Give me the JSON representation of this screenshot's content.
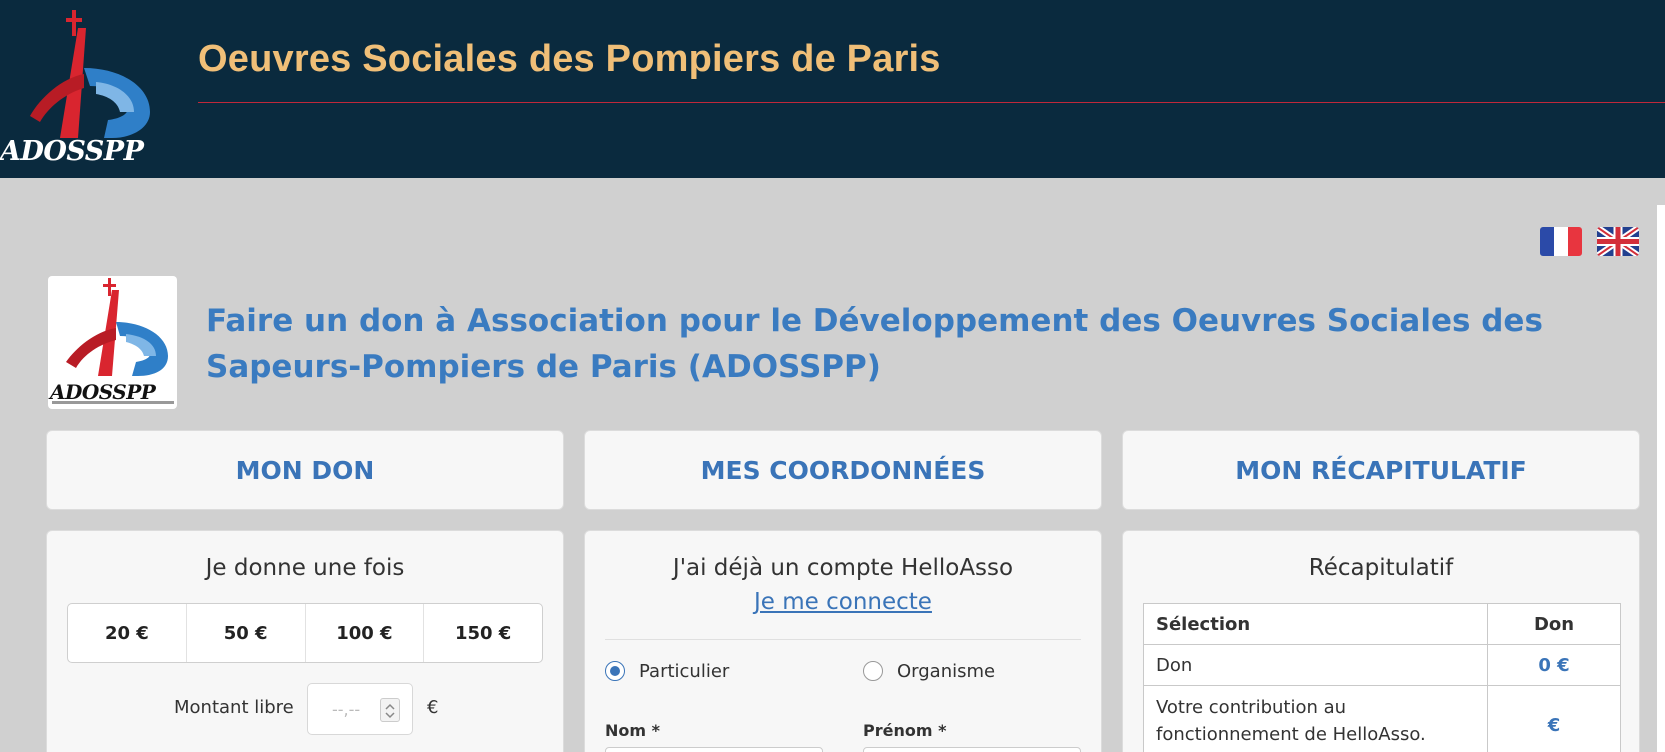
{
  "header": {
    "logo_text": "ADOSSPP",
    "title": "Oeuvres Sociales des Pompiers de Paris"
  },
  "languages": [
    {
      "code": "fr",
      "icon": "france-flag-icon"
    },
    {
      "code": "en",
      "icon": "uk-flag-icon"
    }
  ],
  "org": {
    "logo_text": "ADOSSPP",
    "heading": "Faire un don à Association pour le Développement des Oeuvres Sociales des Sapeurs-Pompiers de Paris (ADOSSPP)"
  },
  "steps": [
    "MON DON",
    "MES COORDONNÉES",
    "MON RÉCAPITULATIF"
  ],
  "donation": {
    "title": "Je donne une fois",
    "amounts": [
      "20 €",
      "50 €",
      "100 €",
      "150 €"
    ],
    "free_label": "Montant libre",
    "free_placeholder": "--,--",
    "currency": "€"
  },
  "account": {
    "title": "J'ai déjà un compte HelloAsso",
    "login_link": "Je me connecte",
    "radio_1": "Particulier",
    "radio_2": "Organisme",
    "selected": "Particulier",
    "field_1_label": "Nom *",
    "field_2_label": "Prénom *"
  },
  "recap": {
    "title": "Récapitulatif",
    "col_selection": "Sélection",
    "col_don": "Don",
    "rows": [
      {
        "label": "Don",
        "value": "0 €"
      },
      {
        "label": "Votre contribution au fonctionnement de HelloAsso.",
        "value": "€"
      }
    ]
  },
  "colors": {
    "header_bg": "#0a2a3e",
    "title_gold": "#f0bf78",
    "accent_blue": "#3a74b8",
    "rule_red": "#c0283a"
  }
}
